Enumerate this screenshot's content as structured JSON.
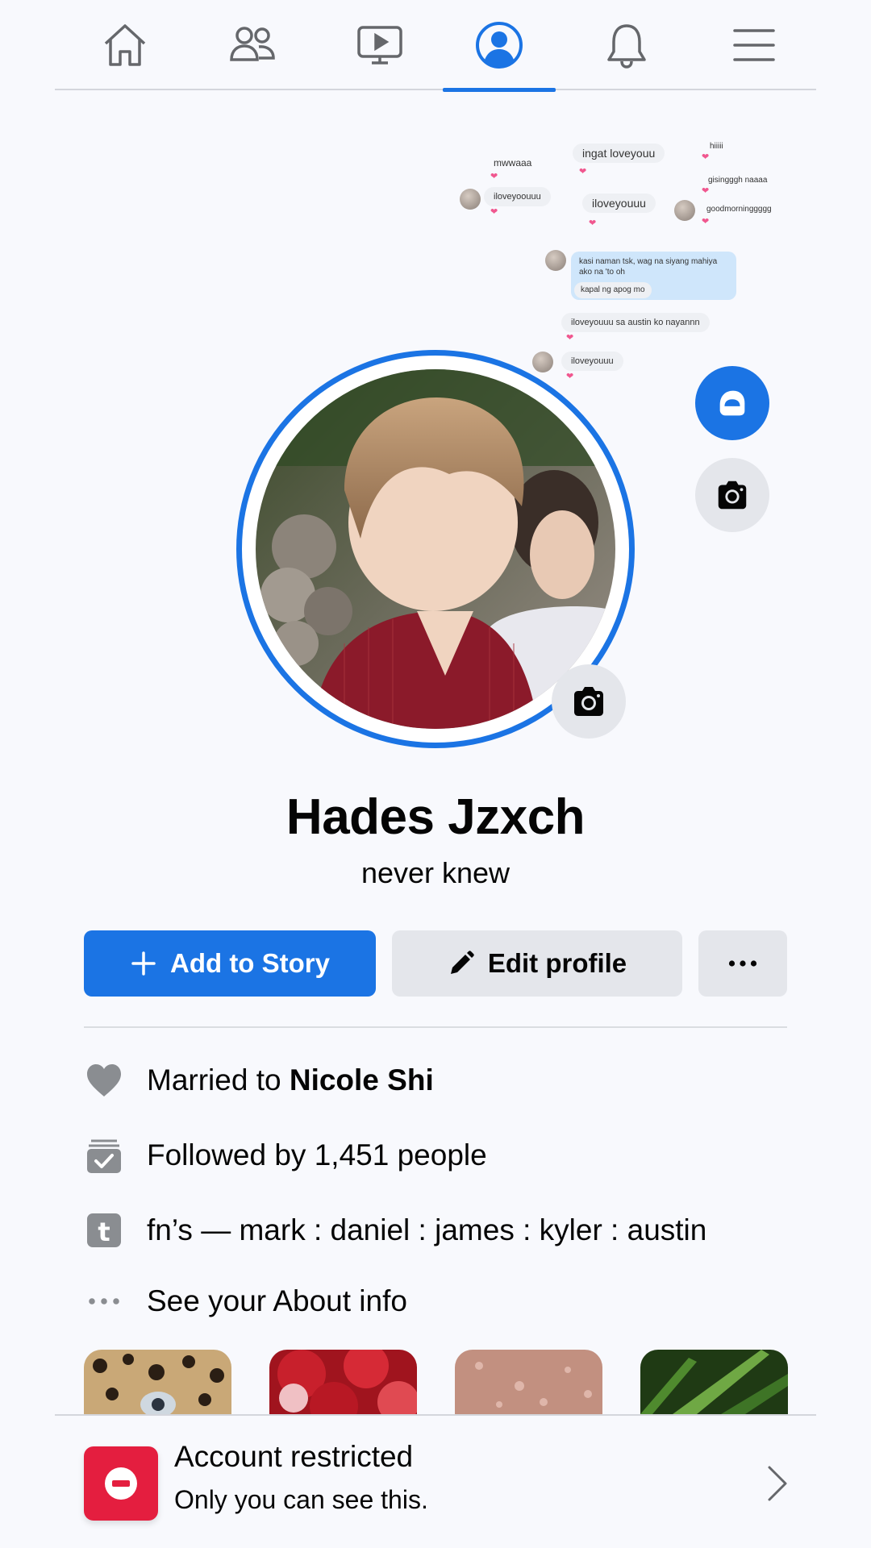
{
  "nav": {
    "tabs": [
      {
        "icon": "home-icon",
        "active": false
      },
      {
        "icon": "friends-icon",
        "active": false
      },
      {
        "icon": "watch-icon",
        "active": false
      },
      {
        "icon": "profile-icon",
        "active": true
      },
      {
        "icon": "bell-icon",
        "active": false
      },
      {
        "icon": "menu-icon",
        "active": false
      }
    ]
  },
  "cover": {
    "messages": [
      {
        "text": "mwwaaa"
      },
      {
        "text": "ingat loveyouu"
      },
      {
        "text": "hiiiii"
      },
      {
        "text": "gisingggh naaaa"
      },
      {
        "text": "iloveyoouuu"
      },
      {
        "text": "iloveyouuu"
      },
      {
        "text": "goodmorninggggg"
      },
      {
        "text": "kasi naman tsk, wag na siyang mahiya ako na 'to oh"
      },
      {
        "text": "kapal ng apog mo"
      },
      {
        "text": "iloveyouuu sa austin ko nayannn"
      },
      {
        "text": "iloveyouuu"
      }
    ],
    "avatar_button_icon": "avatar-icon",
    "cover_camera_icon": "camera-icon"
  },
  "profile": {
    "name": "Hades Jzxch",
    "bio": "never knew"
  },
  "actions": {
    "add_story": "Add to Story",
    "edit_profile": "Edit profile",
    "more_icon": "more-icon"
  },
  "info": {
    "married_prefix": "Married to ",
    "married_name": "Nicole Shi",
    "followed": "Followed by 1,451 people",
    "tumblr": "fn’s — mark : daniel :  james : kyler : austin",
    "about": "See your About info"
  },
  "restricted": {
    "title": "Account restricted",
    "subtitle": "Only you can see this."
  },
  "colors": {
    "accent": "#1b74e4",
    "danger": "#e41e3f",
    "background": "#f8f9fd",
    "button_gray": "#e4e6eb"
  }
}
